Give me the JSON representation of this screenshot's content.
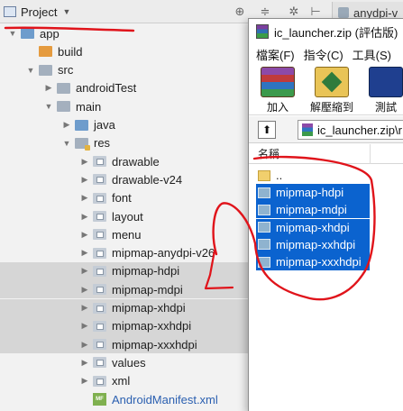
{
  "ide": {
    "panel_title": "Project",
    "tab_label": "anydpi-v",
    "tree": [
      {
        "label": "app",
        "depth": 0,
        "icon": "folder-blue-icon",
        "expanded": true
      },
      {
        "label": "build",
        "depth": 1,
        "icon": "folder-orange-icon",
        "expanded": false,
        "leaf": true
      },
      {
        "label": "src",
        "depth": 1,
        "icon": "folder-icon",
        "expanded": true
      },
      {
        "label": "androidTest",
        "depth": 2,
        "icon": "folder-icon",
        "expanded": false
      },
      {
        "label": "main",
        "depth": 2,
        "icon": "folder-icon",
        "expanded": true
      },
      {
        "label": "java",
        "depth": 3,
        "icon": "folder-blue-icon",
        "expanded": false
      },
      {
        "label": "res",
        "depth": 3,
        "icon": "resource-folder-icon",
        "expanded": true
      },
      {
        "label": "drawable",
        "depth": 4,
        "icon": "res-folder-icon",
        "expanded": false
      },
      {
        "label": "drawable-v24",
        "depth": 4,
        "icon": "res-folder-icon",
        "expanded": false
      },
      {
        "label": "font",
        "depth": 4,
        "icon": "res-folder-icon",
        "expanded": false
      },
      {
        "label": "layout",
        "depth": 4,
        "icon": "res-folder-icon",
        "expanded": false
      },
      {
        "label": "menu",
        "depth": 4,
        "icon": "res-folder-icon",
        "expanded": false
      },
      {
        "label": "mipmap-anydpi-v26",
        "depth": 4,
        "icon": "res-folder-icon",
        "expanded": false
      },
      {
        "label": "mipmap-hdpi",
        "depth": 4,
        "icon": "res-folder-icon",
        "expanded": false,
        "selected": true
      },
      {
        "label": "mipmap-mdpi",
        "depth": 4,
        "icon": "res-folder-icon",
        "expanded": false,
        "selected": true
      },
      {
        "label": "mipmap-xhdpi",
        "depth": 4,
        "icon": "res-folder-icon",
        "expanded": false,
        "selected": true
      },
      {
        "label": "mipmap-xxhdpi",
        "depth": 4,
        "icon": "res-folder-icon",
        "expanded": false,
        "selected": true
      },
      {
        "label": "mipmap-xxxhdpi",
        "depth": 4,
        "icon": "res-folder-icon",
        "expanded": false,
        "selected": true
      },
      {
        "label": "values",
        "depth": 4,
        "icon": "res-folder-icon",
        "expanded": false
      },
      {
        "label": "xml",
        "depth": 4,
        "icon": "res-folder-icon",
        "expanded": false
      },
      {
        "label": "AndroidManifest.xml",
        "depth": 4,
        "icon": "manifest-file-icon",
        "expanded": false,
        "leaf": true,
        "file": true
      }
    ]
  },
  "rar": {
    "title": "ic_launcher.zip (評估版)",
    "menu": [
      "檔案(F)",
      "指令(C)",
      "工具(S)"
    ],
    "tools": [
      {
        "label": "加入",
        "icon": "add-archive-icon"
      },
      {
        "label": "解壓縮到",
        "icon": "extract-to-icon"
      },
      {
        "label": "測試",
        "icon": "test-archive-icon"
      }
    ],
    "path": "ic_launcher.zip\\r",
    "column_header": "名稱",
    "files": [
      {
        "label": "..",
        "type": "parent",
        "selected": false
      },
      {
        "label": "mipmap-hdpi",
        "type": "folder",
        "selected": true
      },
      {
        "label": "mipmap-mdpi",
        "type": "folder",
        "selected": true
      },
      {
        "label": "mipmap-xhdpi",
        "type": "folder",
        "selected": true
      },
      {
        "label": "mipmap-xxhdpi",
        "type": "folder",
        "selected": true
      },
      {
        "label": "mipmap-xxxhdpi",
        "type": "folder",
        "selected": true
      }
    ]
  },
  "colors": {
    "selection_blue": "#0b63cf",
    "ide_selection": "#d6d6d6",
    "annotation_red": "#e0141b"
  }
}
